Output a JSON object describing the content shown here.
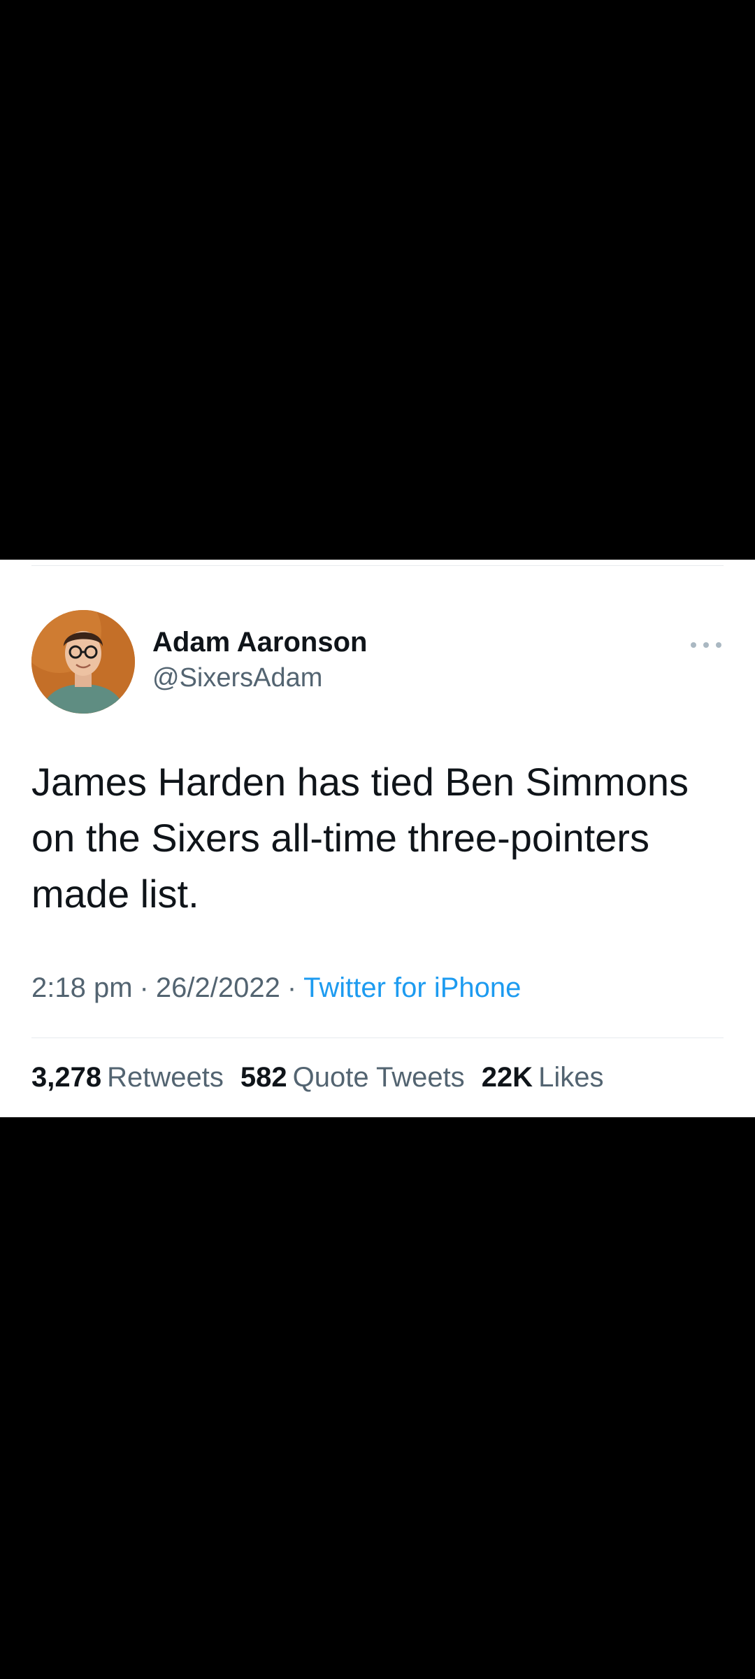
{
  "tweet": {
    "author": {
      "display_name": "Adam Aaronson",
      "handle": "@SixersAdam"
    },
    "more_icon": "more-horizontal-icon",
    "text": "James Harden has tied Ben Simmons on the Sixers all-time three-pointers made list.",
    "time": "2:18 pm",
    "date": "26/2/2022",
    "separator": "·",
    "source": "Twitter for iPhone",
    "stats": {
      "retweets_count": "3,278",
      "retweets_label": "Retweets",
      "quotes_count": "582",
      "quotes_label": "Quote Tweets",
      "likes_count": "22K",
      "likes_label": "Likes"
    }
  },
  "colors": {
    "background": "#000000",
    "card": "#ffffff",
    "primary_text": "#0f1419",
    "secondary_text": "#536471",
    "link": "#1d9bf0",
    "divider": "#e7ebee"
  }
}
